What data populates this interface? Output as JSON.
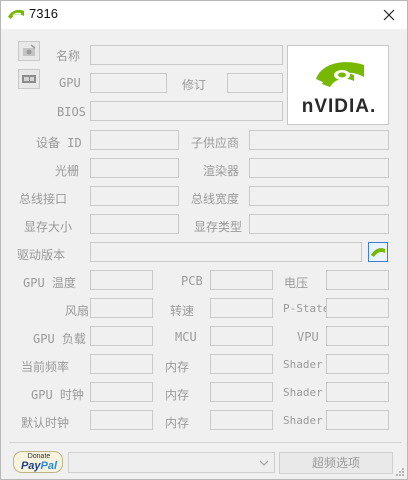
{
  "window": {
    "title": "7316"
  },
  "labels": {
    "name": "名称",
    "gpu": "GPU",
    "revision": "修订",
    "bios": "BIOS",
    "device_id": "设备 ID",
    "subvendor": "子供应商",
    "rops": "光栅",
    "shaders": "渲染器",
    "bus_interface": "总线接口",
    "bus_width": "总线宽度",
    "memory_size": "显存大小",
    "memory_type": "显存类型",
    "driver_version": "驱动版本",
    "gpu_temp": "GPU 温度",
    "pcb": "PCB",
    "voltage": "电压",
    "fan": "风扇",
    "speed": "转速",
    "pstate": "P-State",
    "gpu_load": "GPU 负载",
    "mcu": "MCU",
    "vpu": "VPU",
    "current_clock": "当前频率",
    "gpu_clock": "GPU 时钟",
    "default_clock": "默认时钟",
    "memory": "内存",
    "shader": "Shader"
  },
  "logo": {
    "brand": "nVIDIA."
  },
  "footer": {
    "paypal_small": "Donate",
    "paypal_pay": "Pay",
    "paypal_pal": "Pal",
    "overclock_button": "超频选项"
  },
  "colors": {
    "nvidia_green": "#76b900",
    "label_grey": "#9a9a9a"
  }
}
